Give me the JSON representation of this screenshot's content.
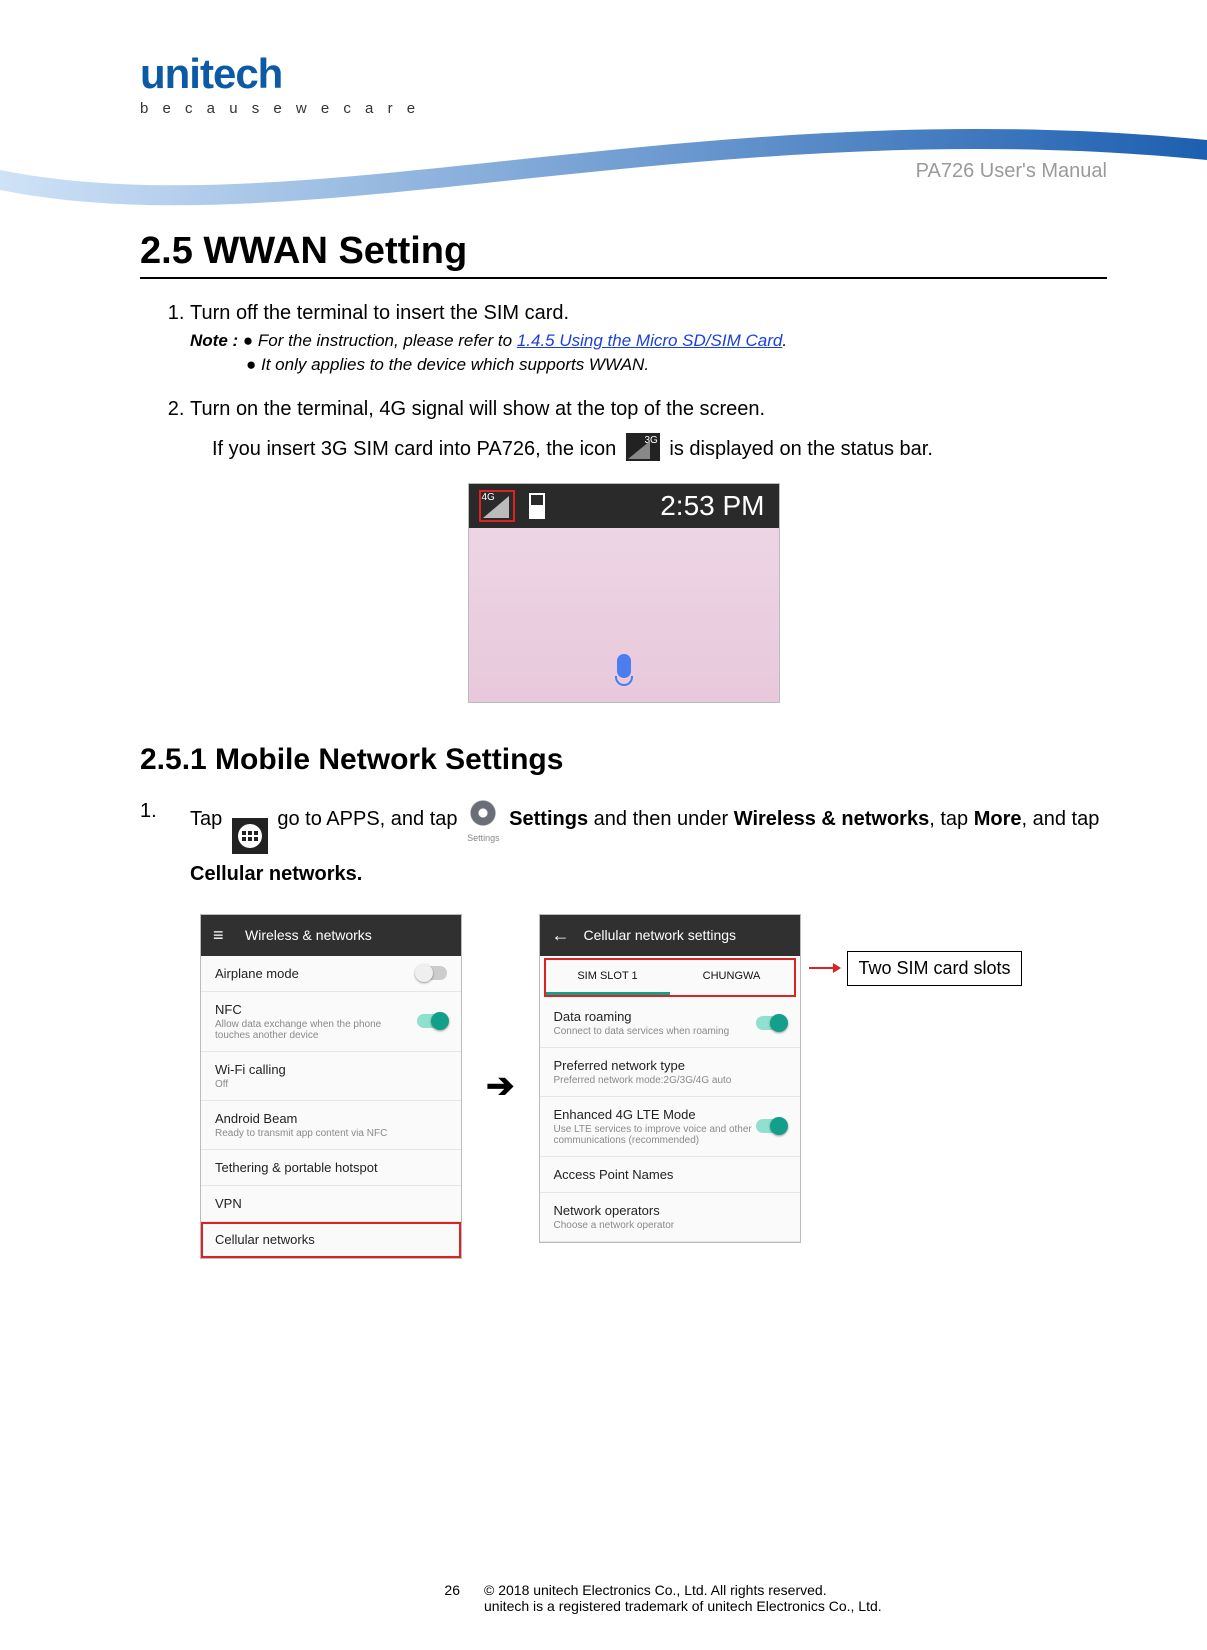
{
  "header": {
    "logo_name": "unitech",
    "logo_sep_before": "t",
    "logo_sep_after": "ch",
    "tagline": "b e c a u s e   w e   c a r e",
    "doc_title": "PA726 User's Manual"
  },
  "section": {
    "number_title": "2.5 WWAN Setting",
    "steps": {
      "s1": {
        "text": "Turn off the terminal to insert the SIM card.",
        "note_label": "Note :",
        "note_bullet": "●",
        "note1_a": "For the instruction, please refer to ",
        "note1_link": "1.4.5 Using the Micro SD/SIM Card",
        "note1_b": ".",
        "note2": "It only applies to the device which supports WWAN."
      },
      "s2": {
        "text": "Turn on the terminal, 4G signal will show at the top of the screen.",
        "line2a": "If you insert 3G SIM card into PA726, the icon ",
        "line2b": " is displayed on the status bar."
      }
    },
    "statusbar": {
      "sig_label": "4G",
      "clock": "2:53 PM"
    }
  },
  "subsection": {
    "number_title": "2.5.1 Mobile Network Settings",
    "step1": {
      "num_label": "1.",
      "p1a": "Tap ",
      "p1b": " go to APPS, and tap ",
      "settings_caption": "Settings",
      "p1c": " Settings",
      "p1d": " and then under ",
      "p1e": "Wireless & networks",
      "p1f": ", tap ",
      "p1g": "More",
      "p1h": ", and tap ",
      "p1i": "Cellular networks."
    }
  },
  "shot_left": {
    "appbar_title": "Wireless & networks",
    "rows": {
      "airplane": {
        "title": "Airplane mode"
      },
      "nfc": {
        "title": "NFC",
        "sub": "Allow data exchange when the phone touches another device"
      },
      "wifi_calling": {
        "title": "Wi-Fi calling",
        "sub": "Off"
      },
      "beam": {
        "title": "Android Beam",
        "sub": "Ready to transmit app content via NFC"
      },
      "tether": {
        "title": "Tethering & portable hotspot"
      },
      "vpn": {
        "title": "VPN"
      },
      "cell": {
        "title": "Cellular networks"
      }
    }
  },
  "shot_right": {
    "appbar_title": "Cellular network settings",
    "tabs": {
      "slot1": "SIM SLOT 1",
      "slot2": "CHUNGWA"
    },
    "rows": {
      "roaming": {
        "title": "Data roaming",
        "sub": "Connect to data services when roaming"
      },
      "pref": {
        "title": "Preferred network type",
        "sub": "Preferred network mode:2G/3G/4G auto"
      },
      "lte": {
        "title": "Enhanced 4G LTE Mode",
        "sub": "Use LTE services to improve voice and other communications (recommended)"
      },
      "apn": {
        "title": "Access Point Names"
      },
      "ops": {
        "title": "Network operators",
        "sub": "Choose a network operator"
      }
    },
    "callout": "Two SIM card slots"
  },
  "footer": {
    "page_number": "26",
    "line1": "© 2018 unitech Electronics Co., Ltd. All rights reserved.",
    "line2": "unitech is a registered trademark of unitech Electronics Co., Ltd."
  }
}
